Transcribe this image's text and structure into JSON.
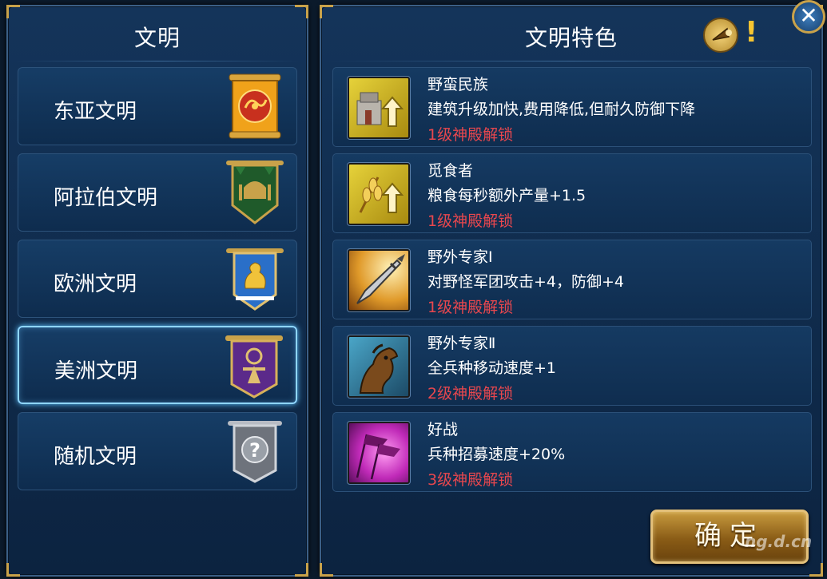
{
  "left_panel": {
    "title": "文明",
    "civilizations": [
      {
        "label": "东亚文明",
        "banner": "dragon-banner-icon",
        "selected": false
      },
      {
        "label": "阿拉伯文明",
        "banner": "mosque-banner-icon",
        "selected": false
      },
      {
        "label": "欧洲文明",
        "banner": "lion-banner-icon",
        "selected": false
      },
      {
        "label": "美洲文明",
        "banner": "aztec-banner-icon",
        "selected": true
      },
      {
        "label": "随机文明",
        "banner": "question-banner-icon",
        "selected": false
      }
    ]
  },
  "right_panel": {
    "title": "文明特色",
    "info_mark": "!",
    "features": [
      {
        "name": "野蛮民族",
        "description": "建筑升级加快,费用降低,但耐久防御下降",
        "unlock": "1级神殿解锁",
        "icon": "building-upgrade-icon"
      },
      {
        "name": "觅食者",
        "description": "粮食每秒额外产量+1.5",
        "unlock": "1级神殿解锁",
        "icon": "wheat-upgrade-icon"
      },
      {
        "name": "野外专家Ⅰ",
        "description": "对野怪军团攻击+4，防御+4",
        "unlock": "1级神殿解锁",
        "icon": "spear-icon"
      },
      {
        "name": "野外专家Ⅱ",
        "description": "全兵种移动速度+1",
        "unlock": "2级神殿解锁",
        "icon": "horse-icon"
      },
      {
        "name": "好战",
        "description": "兵种招募速度+20%",
        "unlock": "3级神殿解锁",
        "icon": "war-flags-icon"
      }
    ],
    "confirm_label": "确定",
    "watermark": "ng.d.cn"
  },
  "close_label": "✕",
  "colors": {
    "unlock_text": "#e8474e",
    "panel_bg": "#123257",
    "gold_trim": "#c9a24a",
    "selected_glow": "#8fd6ff"
  }
}
